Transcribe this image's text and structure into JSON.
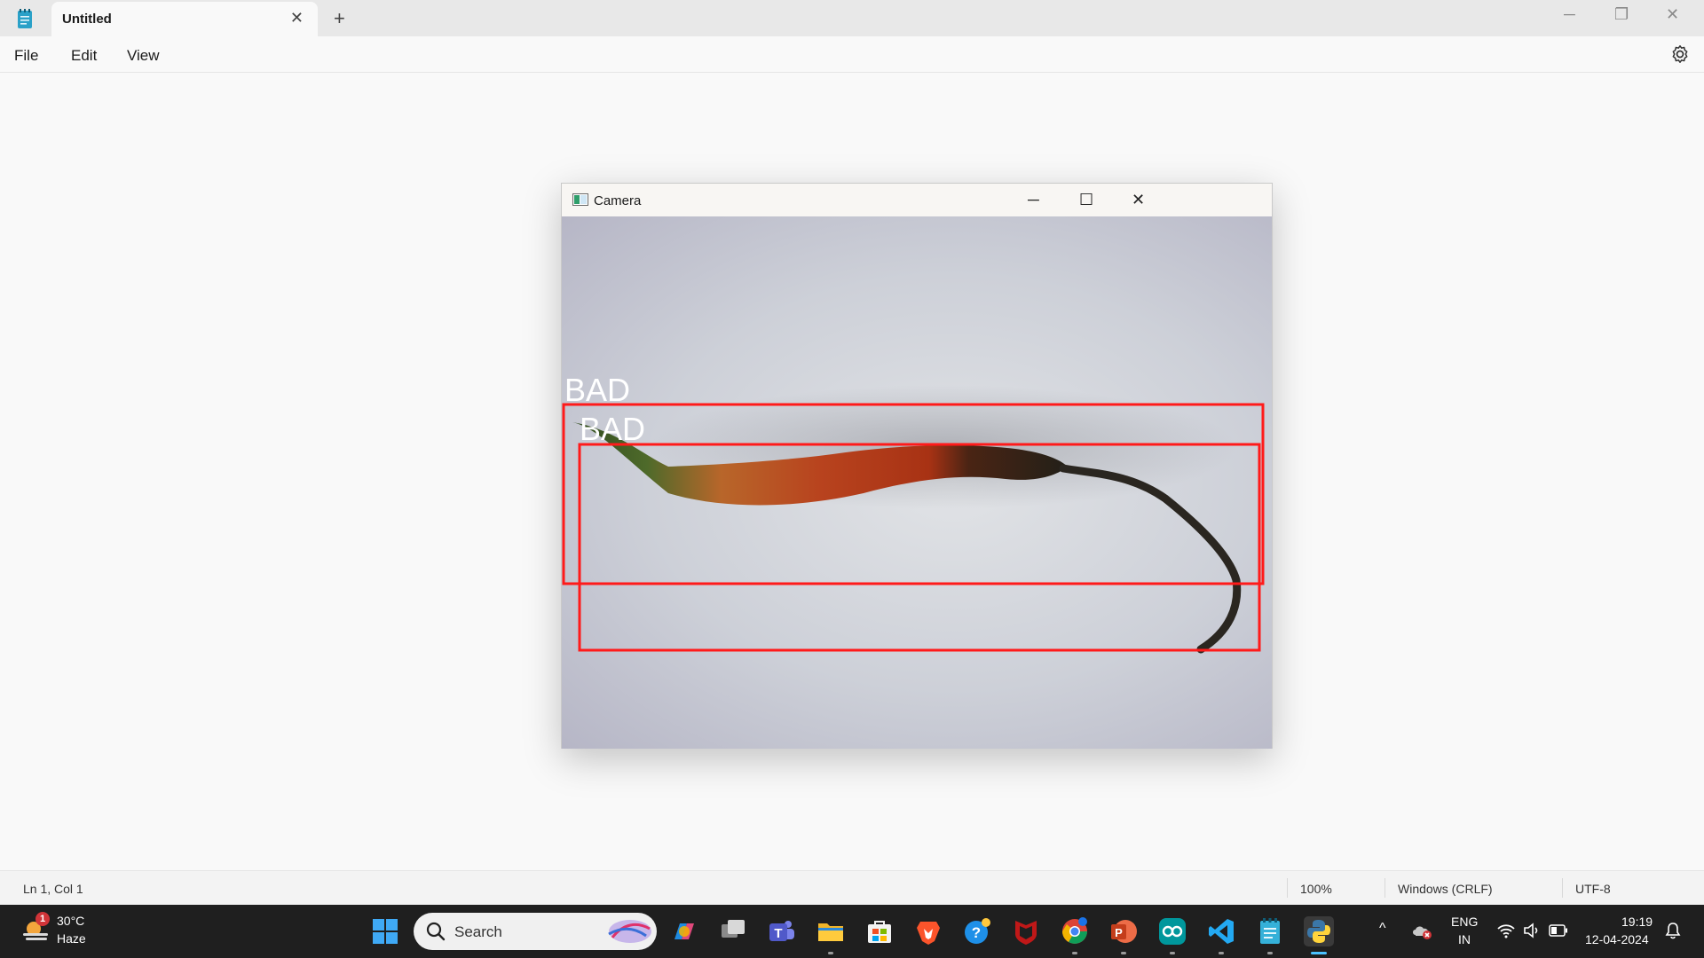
{
  "notepad": {
    "tab_title": "Untitled",
    "tab_close_icon": "close-icon",
    "new_tab_icon": "plus-icon",
    "menu": [
      "File",
      "Edit",
      "View"
    ],
    "settings_icon": "gear-icon",
    "editor_text": ""
  },
  "window_controls": {
    "minimize": "─",
    "restore": "❐",
    "close": "✕"
  },
  "status": {
    "position": "Ln 1, Col 1",
    "zoom": "100%",
    "line_ending": "Windows (CRLF)",
    "encoding": "UTF-8"
  },
  "camera_window": {
    "title": "Camera",
    "minimize": "─",
    "maximize": "☐",
    "close": "✕",
    "detections": [
      {
        "label": "BAD"
      },
      {
        "label": "BAD"
      }
    ],
    "box_color": "#ff1a1a",
    "label_color": "#ffffff"
  },
  "taskbar": {
    "weather": {
      "badge": "1",
      "temperature": "30°C",
      "condition": "Haze"
    },
    "search_placeholder": "Search",
    "apps": [
      "start-icon",
      "search-icon",
      "copilot-icon",
      "task-view-icon",
      "teams-icon",
      "file-explorer-icon",
      "store-icon",
      "brave-icon",
      "help-icon",
      "mcafee-icon",
      "chrome-icon",
      "powerpoint-icon",
      "arduino-icon",
      "vscode-icon",
      "notepad-icon",
      "python-icon"
    ],
    "tray": {
      "language_top": "ENG",
      "language_bottom": "IN",
      "time": "19:19",
      "date": "12-04-2024"
    }
  }
}
